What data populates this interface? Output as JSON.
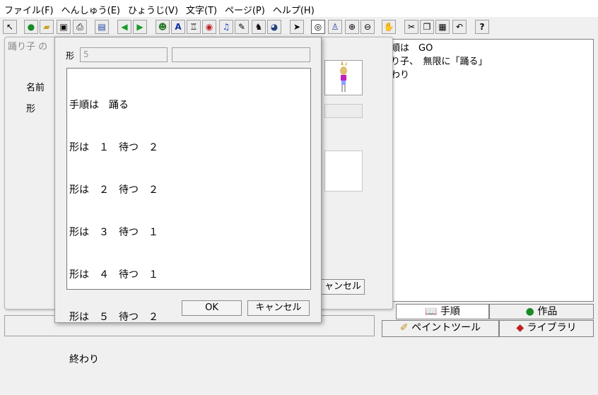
{
  "menu": [
    "ファイル(F)",
    "へんしゅう(E)",
    "ひょうじ(V)",
    "文字(T)",
    "ページ(P)",
    "ヘルプ(H)"
  ],
  "toolbar_icons": [
    "pointer-select-icon",
    "globe-icon",
    "open-folder-icon",
    "save-icon",
    "print-icon",
    "book-icon",
    "arrow-left-icon",
    "arrow-right-icon",
    "character-icon",
    "text-a-icon",
    "robot-icon",
    "eye-shape-icon",
    "music-note-icon",
    "pencil-icon",
    "crowd-icon",
    "disk-face-icon",
    "cursor-arrow-icon",
    "view-eye-icon",
    "stamp-icon",
    "zoom-in-icon",
    "zoom-out-icon",
    "stop-hand-icon",
    "scissors-icon",
    "copy-icon",
    "paste-icon",
    "undo-icon",
    "help-icon"
  ],
  "right_pane": {
    "lines": [
      "順は　GO",
      "り子、　無限に「踊る」",
      "わり"
    ]
  },
  "tabs": {
    "procedure": "手順",
    "works": "作品",
    "paint_tool": "ペイントツール",
    "library": "ライブラリ"
  },
  "back_dialog": {
    "title": "踊り子 の",
    "name_label": "名前",
    "shape_label": "形",
    "cancel_label": "ャンセル"
  },
  "front_dialog": {
    "shape_label": "形",
    "shape_value": "5",
    "script_lines": [
      "手順は　踊る",
      "形は　１　待つ　２",
      "形は　２　待つ　２",
      "形は　３　待つ　１",
      "形は　４　待つ　１",
      "形は　５　待つ　２",
      "終わり"
    ],
    "ok_label": "OK",
    "cancel_label": "キャンセル"
  }
}
